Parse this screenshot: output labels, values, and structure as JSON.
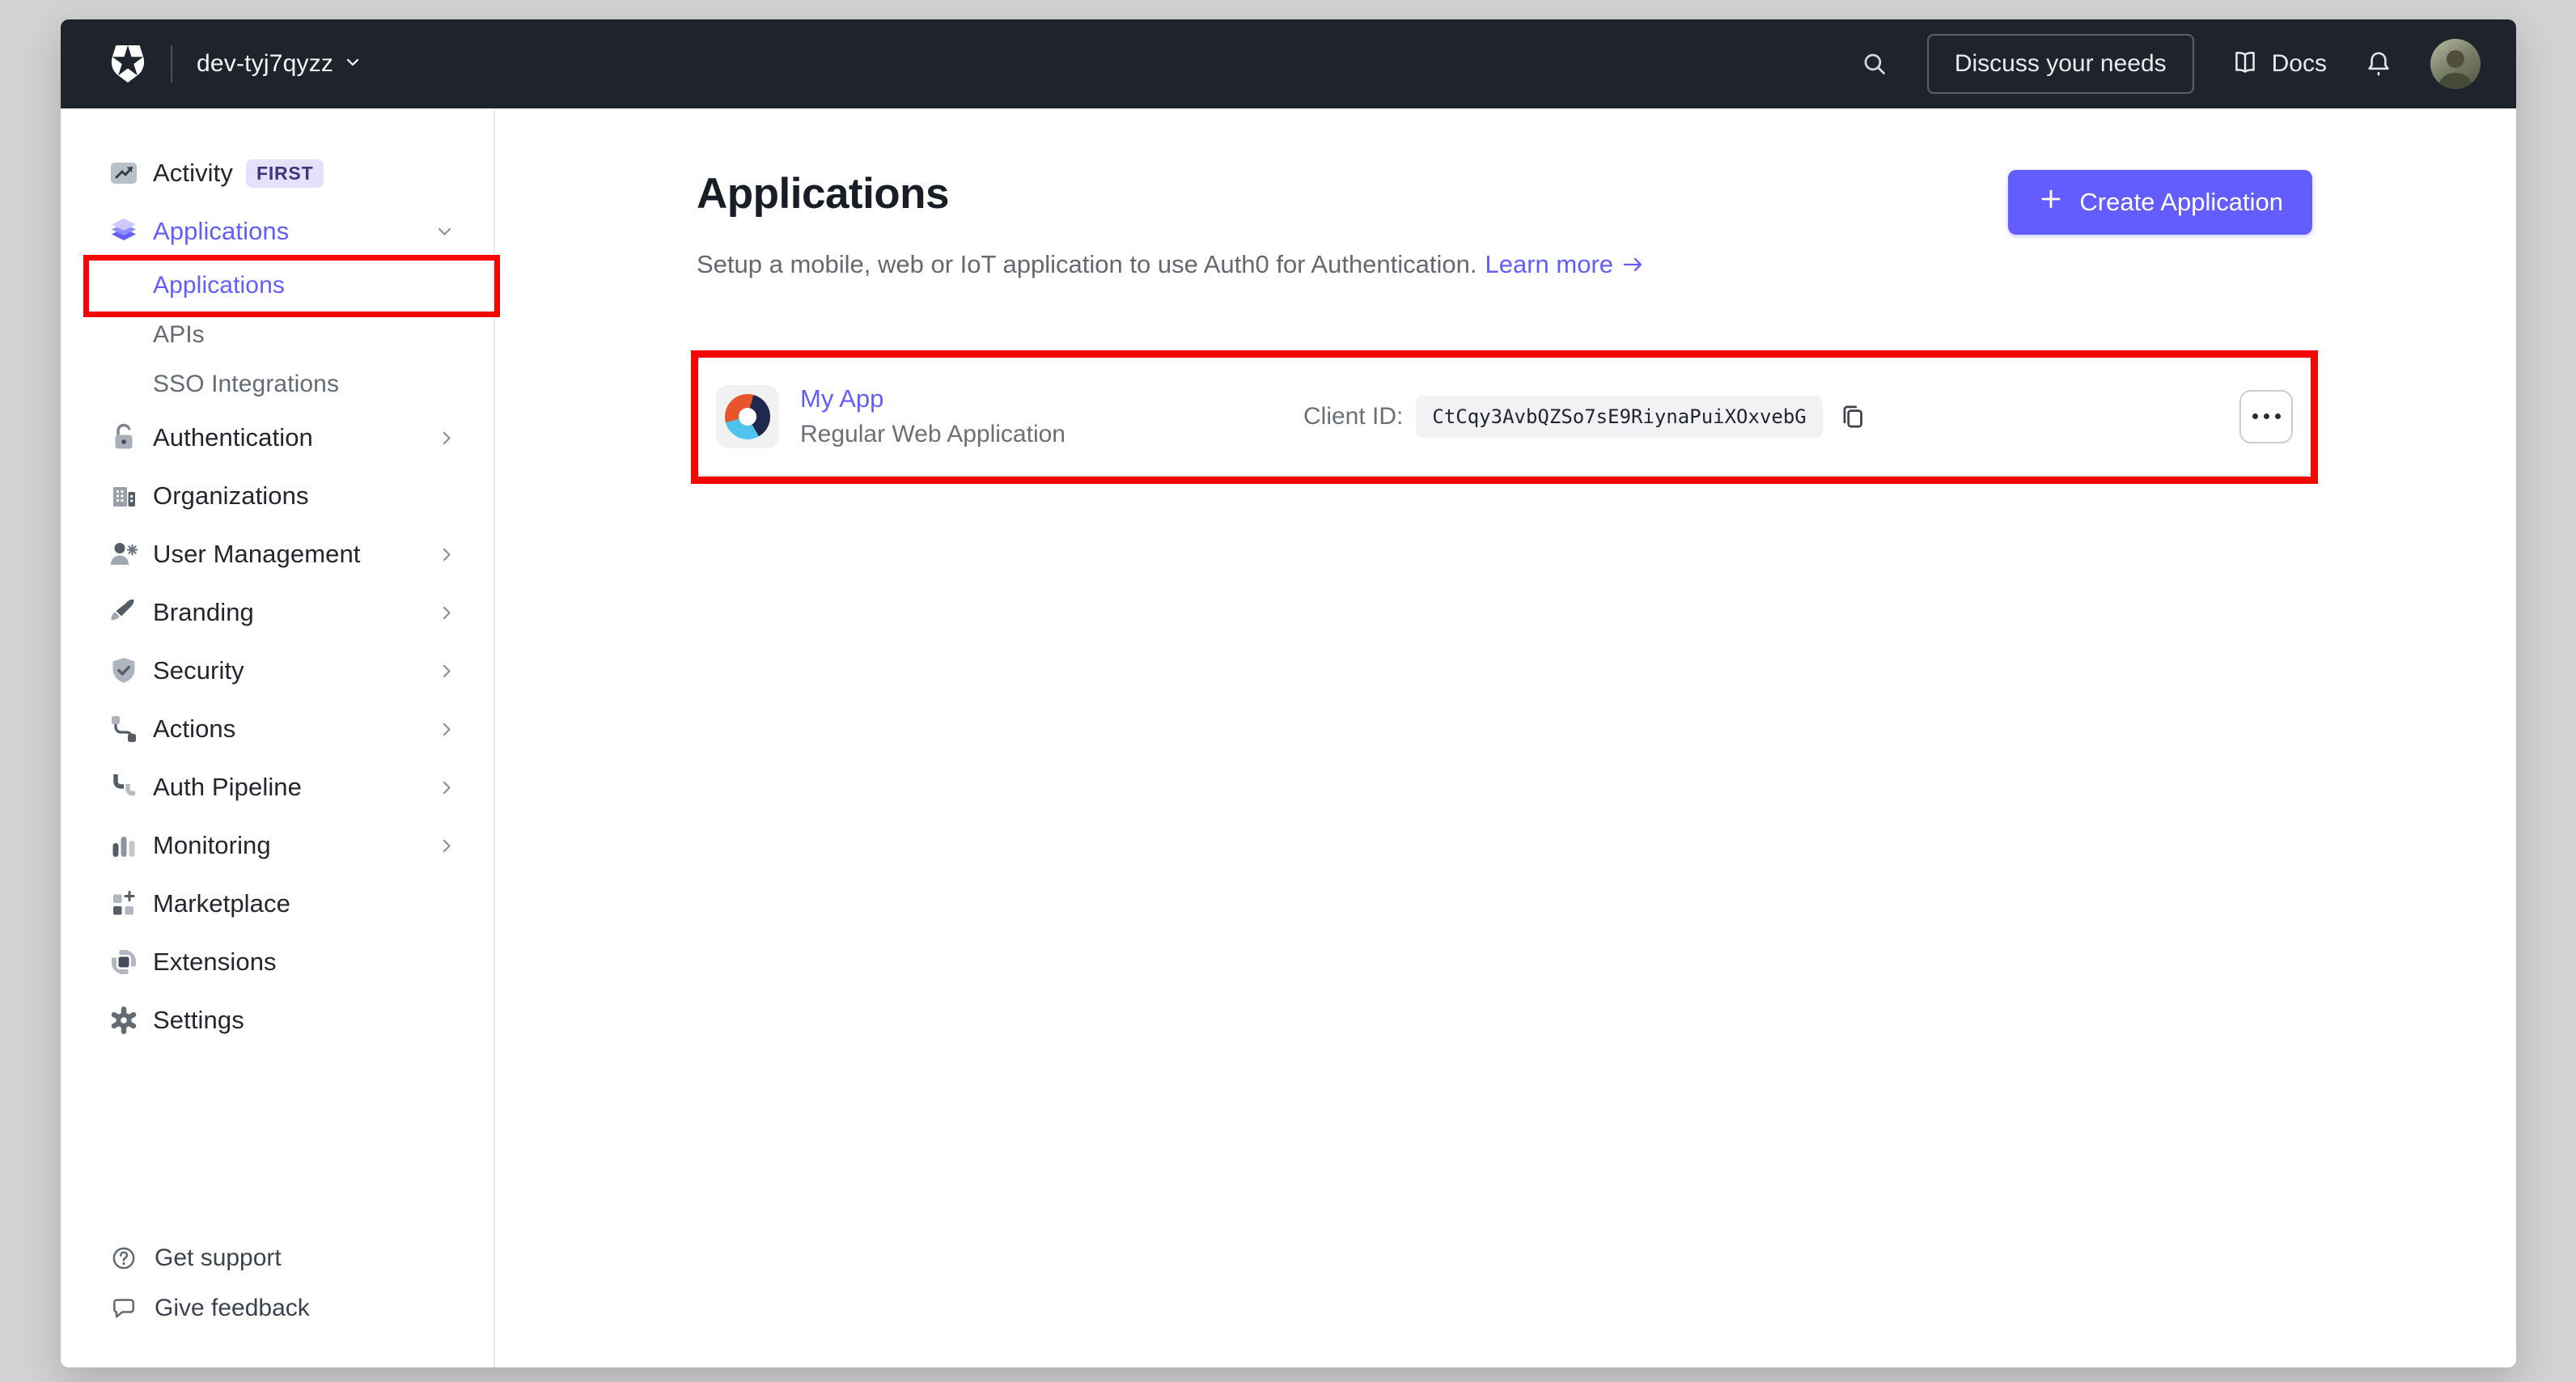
{
  "topbar": {
    "tenant": "dev-tyj7qyzz",
    "discuss_label": "Discuss your needs",
    "docs_label": "Docs",
    "icons": {
      "logo": "auth0-shield-star",
      "search": "magnifier",
      "docs": "open-book",
      "notifications": "bell",
      "account": "user-photo-avatar"
    }
  },
  "sidebar": {
    "items": [
      {
        "label": "Activity",
        "icon": "activity-trend-chart",
        "badge": "FIRST"
      },
      {
        "label": "Applications",
        "icon": "stacked-layers",
        "chevron": "down",
        "active": true
      },
      {
        "label": "Applications",
        "type": "sub",
        "active": true,
        "annotated": true
      },
      {
        "label": "APIs",
        "type": "sub"
      },
      {
        "label": "SSO Integrations",
        "type": "sub"
      },
      {
        "label": "Authentication",
        "icon": "open-padlock",
        "chevron": "right"
      },
      {
        "label": "Organizations",
        "icon": "buildings"
      },
      {
        "label": "User Management",
        "icon": "user-with-gear",
        "chevron": "right"
      },
      {
        "label": "Branding",
        "icon": "paintbrush",
        "chevron": "right"
      },
      {
        "label": "Security",
        "icon": "shield-check",
        "chevron": "right"
      },
      {
        "label": "Actions",
        "icon": "flow-connector",
        "chevron": "right"
      },
      {
        "label": "Auth Pipeline",
        "icon": "pipeline-elbows",
        "chevron": "right"
      },
      {
        "label": "Monitoring",
        "icon": "bar-chart",
        "chevron": "right"
      },
      {
        "label": "Marketplace",
        "icon": "grid-plus"
      },
      {
        "label": "Extensions",
        "icon": "chip"
      },
      {
        "label": "Settings",
        "icon": "gear"
      }
    ],
    "footer": [
      {
        "label": "Get support",
        "icon": "question-circle"
      },
      {
        "label": "Give feedback",
        "icon": "speech-bubble"
      }
    ]
  },
  "main": {
    "title": "Applications",
    "subtitle": "Setup a mobile, web or IoT application to use Auth0 for Authentication.",
    "learn_more_label": "Learn more",
    "create_button_label": "Create Application",
    "application": {
      "name": "My App",
      "type": "Regular Web Application",
      "client_id_label": "Client ID:",
      "client_id": "CtCqy3AvbQZSo7sE9RiynaPuiXOxvebG"
    }
  },
  "colors": {
    "accent": "#635dff",
    "topbar_bg": "#1f232c",
    "annotation_red": "#f60505",
    "badge_bg": "#e4e1fc",
    "badge_text": "#40357f",
    "donut_orange": "#e8542b",
    "donut_navy": "#20294d",
    "donut_blue": "#4fc3ed"
  }
}
